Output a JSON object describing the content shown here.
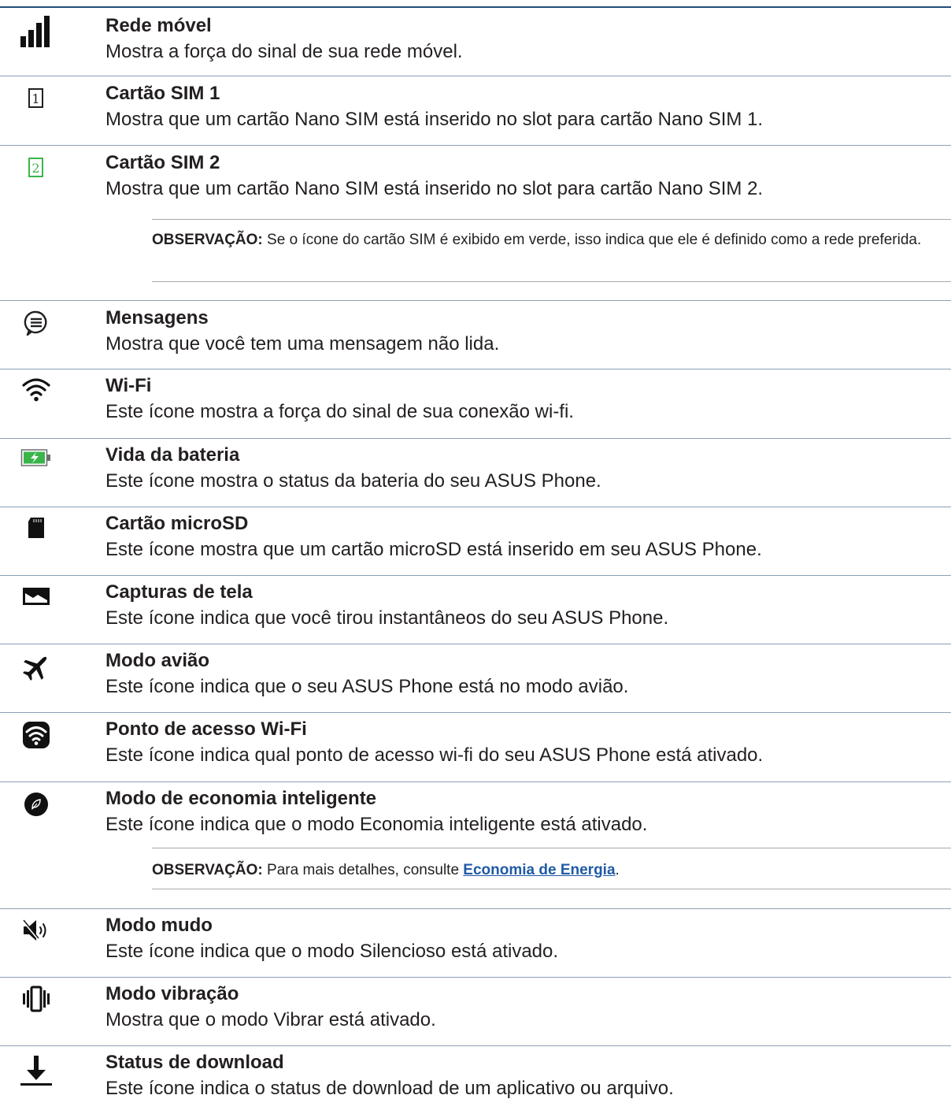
{
  "items": [
    {
      "title": "Rede móvel",
      "desc": "Mostra a força do sinal de sua rede móvel.",
      "icon": "signal-bars-icon"
    },
    {
      "title": "Cartão SIM 1",
      "desc": "Mostra que um cartão Nano SIM está inserido no slot para cartão Nano SIM 1.",
      "icon": "sim-card-1-icon"
    },
    {
      "title": "Cartão SIM 2",
      "desc": "Mostra que um cartão Nano SIM está inserido no slot para cartão Nano SIM 2.",
      "icon": "sim-card-2-icon"
    },
    {
      "title": "Mensagens",
      "desc": "Mostra que você tem uma mensagem não lida.",
      "icon": "message-bubble-icon"
    },
    {
      "title": "Wi-Fi",
      "desc": "Este ícone mostra a força do sinal de sua conexão wi-fi.",
      "icon": "wifi-icon"
    },
    {
      "title": "Vida da bateria",
      "desc": "Este ícone mostra o status da bateria do seu ASUS Phone.",
      "icon": "battery-charging-icon"
    },
    {
      "title": "Cartão microSD",
      "desc": "Este ícone mostra que um cartão microSD está inserido em seu ASUS Phone.",
      "icon": "microsd-card-icon"
    },
    {
      "title": "Capturas de tela",
      "desc": "Este ícone indica que você tirou instantâneos do seu ASUS Phone.",
      "icon": "screenshot-icon"
    },
    {
      "title": "Modo avião",
      "desc": "Este ícone indica que o seu ASUS Phone está no modo avião.",
      "icon": "airplane-icon"
    },
    {
      "title": "Ponto de acesso Wi-Fi",
      "desc": "Este ícone indica qual ponto de acesso wi-fi do seu ASUS Phone está ativado.",
      "icon": "wifi-hotspot-icon"
    },
    {
      "title": "Modo de economia inteligente",
      "desc": "Este ícone indica que o modo Economia inteligente está ativado.",
      "icon": "smart-saving-leaf-icon"
    },
    {
      "title": "Modo mudo",
      "desc": "Este ícone indica que o modo Silencioso está ativado.",
      "icon": "mute-speaker-icon"
    },
    {
      "title": "Modo vibração",
      "desc": "Mostra que o modo Vibrar está ativado.",
      "icon": "vibrate-icon"
    },
    {
      "title": "Status de download",
      "desc": "Este ícone indica o status de download de um aplicativo ou arquivo.",
      "icon": "download-arrow-icon"
    }
  ],
  "notes": [
    {
      "label": "OBSERVAÇÃO:",
      "text": " Se o ícone do cartão SIM é exibido em verde, isso indica que ele é definido como a rede preferida."
    },
    {
      "label": "OBSERVAÇÃO:",
      "text": " Para mais detalhes, consulte ",
      "link": "Economia de Energia",
      "after": "."
    }
  ],
  "colors": {
    "accent_green": "#3ab54a",
    "link": "#1f5aa6",
    "rule": "#1f4e79"
  }
}
